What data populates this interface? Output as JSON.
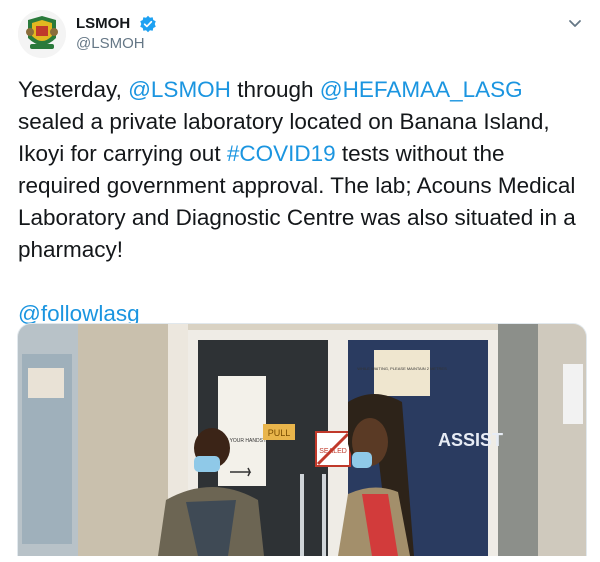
{
  "header": {
    "display_name": "LSMOH",
    "handle": "@LSMOH",
    "caret_icon": "chevron-down-icon",
    "verified_icon": "verified-badge-icon"
  },
  "tweet": {
    "seg1": "Yesterday, ",
    "mention1": "@LSMOH",
    "seg2": " through ",
    "mention2": "@HEFAMAA_LASG",
    "seg3": " sealed a private laboratory located on Banana Island, Ikoyi for carrying out ",
    "hashtag": "#COVID19",
    "seg4": "  tests without the required government approval. The lab; Acouns Medical Laboratory and Diagnostic Centre was also situated in a pharmacy!",
    "mention3": "@followlasg"
  },
  "photo": {
    "sign_sanitize": "SANITIZE YOUR HANDS HERE",
    "sign_pull": "PULL",
    "sign_sealed": "SEALED",
    "sign_assist": "ASSIST",
    "sign_small": "WHILE WAITING, PLEASE MAINTAIN 2 METRES"
  },
  "colors": {
    "link": "#1b95e0",
    "verified": "#1da1f2",
    "text": "#14171a",
    "muted": "#657786"
  }
}
